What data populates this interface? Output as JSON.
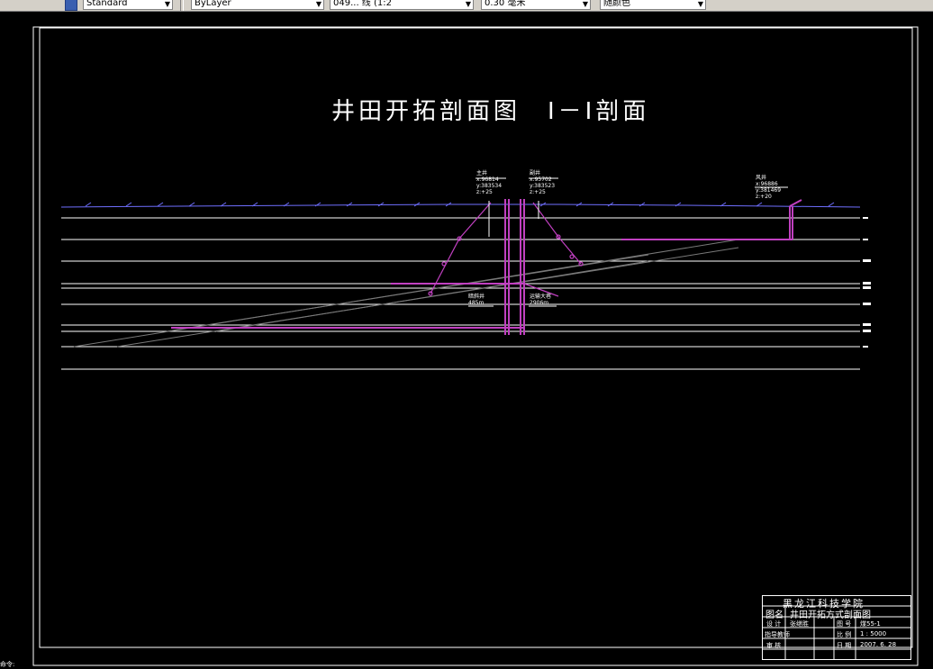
{
  "toolbar": {
    "text_style": "Standard",
    "layer": "ByLayer",
    "linetype": "049... 线 (1:2",
    "lineweight": "0.30 毫米",
    "color": "随颜色"
  },
  "drawing": {
    "title": "井田开拓剖面图　Ⅰ－Ⅰ剖面",
    "shafts": [
      {
        "name": "主井",
        "x": "x:96814",
        "y": "y:383534",
        "z": "z:+25"
      },
      {
        "name": "副井",
        "x": "x:95702",
        "y": "y:383523",
        "z": "z:+25"
      },
      {
        "name": "风井",
        "x": "x:96886",
        "y": "y:381469",
        "z": "z:+20"
      }
    ],
    "left_label": {
      "line1": "暗斜井",
      "line2": "485m"
    },
    "right_label": {
      "line1": "运输大巷",
      "line2": "2906m"
    }
  },
  "title_block": {
    "institute": "黑龙江科技学院",
    "drawing_label": "图名",
    "drawing_name": "井田开拓方式剖面图",
    "row1": {
      "a": "设 计",
      "b": "张继胜",
      "c": "图 号",
      "d": "煤55-1"
    },
    "row2": {
      "a": "指导教师",
      "b": "",
      "c": "比 例",
      "d": "1 : 5000"
    },
    "row3": {
      "a": "审 核",
      "b": "",
      "c": "日 期",
      "d": "2007. 6. 28"
    }
  },
  "status": {
    "text": "命令:"
  }
}
